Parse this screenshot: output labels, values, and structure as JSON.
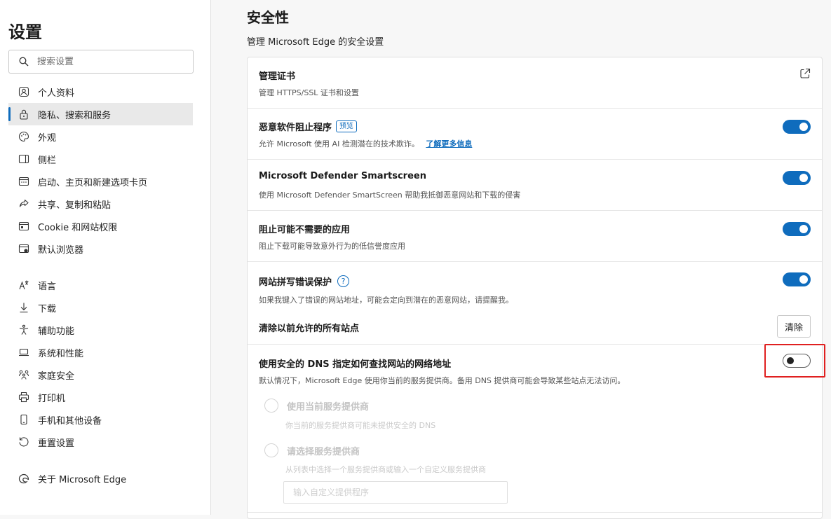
{
  "sidebar": {
    "title": "设置",
    "search_placeholder": "搜索设置",
    "items": [
      {
        "label": "个人资料",
        "icon": "profile-icon"
      },
      {
        "label": "隐私、搜索和服务",
        "icon": "lock-icon",
        "active": true
      },
      {
        "label": "外观",
        "icon": "palette-icon"
      },
      {
        "label": "侧栏",
        "icon": "sidebar-icon"
      },
      {
        "label": "启动、主页和新建选项卡页",
        "icon": "home-icon"
      },
      {
        "label": "共享、复制和粘贴",
        "icon": "share-icon"
      },
      {
        "label": "Cookie 和网站权限",
        "icon": "site-permissions-icon"
      },
      {
        "label": "默认浏览器",
        "icon": "browser-icon"
      },
      {
        "label": "语言",
        "icon": "language-icon"
      },
      {
        "label": "下载",
        "icon": "download-icon"
      },
      {
        "label": "辅助功能",
        "icon": "accessibility-icon"
      },
      {
        "label": "系统和性能",
        "icon": "laptop-icon"
      },
      {
        "label": "家庭安全",
        "icon": "family-icon"
      },
      {
        "label": "打印机",
        "icon": "printer-icon"
      },
      {
        "label": "手机和其他设备",
        "icon": "phone-icon"
      },
      {
        "label": "重置设置",
        "icon": "reset-icon"
      },
      {
        "label": "关于 Microsoft Edge",
        "icon": "edge-logo-icon"
      }
    ]
  },
  "main": {
    "title": "安全性",
    "subtitle": "管理 Microsoft Edge 的安全设置",
    "certs": {
      "title": "管理证书",
      "desc": "管理 HTTPS/SSL 证书和设置"
    },
    "malware": {
      "title": "恶意软件阻止程序",
      "badge": "预览",
      "desc": "允许 Microsoft 使用 AI 检测潜在的技术欺诈。",
      "link": "了解更多信息",
      "enabled": true
    },
    "smartscreen": {
      "title": "Microsoft Defender Smartscreen",
      "desc": "使用 Microsoft Defender SmartScreen 帮助我抵御恶意网站和下载的侵害",
      "enabled": true
    },
    "pua": {
      "title": "阻止可能不需要的应用",
      "desc": "阻止下载可能导致意外行为的低信誉度应用",
      "enabled": true
    },
    "typo": {
      "title": "网站拼写错误保护",
      "help": "?",
      "desc": "如果我键入了错误的网站地址，可能会定向到潜在的恶意网站，请提醒我。",
      "enabled": true
    },
    "clear_sites": {
      "title": "清除以前允许的所有站点",
      "button": "清除"
    },
    "dns": {
      "title": "使用安全的 DNS 指定如何查找网站的网络地址",
      "desc": "默认情况下，Microsoft Edge 使用你当前的服务提供商。备用 DNS 提供商可能会导致某些站点无法访问。",
      "enabled": false,
      "option1": {
        "label": "使用当前服务提供商",
        "desc": "你当前的服务提供商可能未提供安全的 DNS"
      },
      "option2": {
        "label": "请选择服务提供商",
        "desc": "从列表中选择一个服务提供商或输入一个自定义服务提供商"
      },
      "custom_placeholder": "输入自定义提供程序"
    }
  },
  "colors": {
    "accent": "#0f6cbd",
    "highlight": "#e02020"
  }
}
